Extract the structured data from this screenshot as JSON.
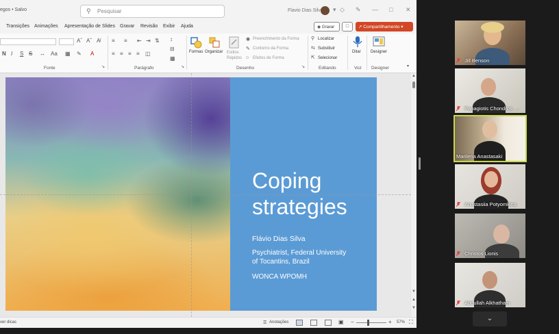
{
  "window": {
    "file_title": "egos • Salvo",
    "search_placeholder": "Pesquisar",
    "user_name": "Flavio Dias Silva"
  },
  "menu": {
    "tabs": [
      "Transições",
      "Animações",
      "Apresentação de Slides",
      "Gravar",
      "Revisão",
      "Exibir",
      "Ajuda"
    ],
    "record_label": "Gravar",
    "share_label": "Compartilhamento"
  },
  "ribbon": {
    "groups": [
      "Fonte",
      "Parágrafo",
      "Desenho",
      "Editando",
      "Voz",
      "Designer"
    ],
    "font_buttons": [
      "N",
      "I",
      "S",
      "S"
    ],
    "drawing": {
      "shapes": "Formas",
      "arrange": "Organizar",
      "quick_styles": "Estilos Rápidos",
      "fill": "Preenchimento da Forma",
      "outline": "Contorno da Forma",
      "effects": "Efeitos de Forma"
    },
    "editing": {
      "find": "Localizar",
      "replace": "Substituir",
      "select": "Selecionar"
    },
    "voice": {
      "dictate": "Ditar"
    },
    "designer": {
      "label": "Designer"
    }
  },
  "slide": {
    "title_line1": "Coping",
    "title_line2": "strategies",
    "author": "Flávio Dias Silva",
    "affiliation_line1": "Psychiatrist, Federal University",
    "affiliation_line2": "of Tocantins, Brazil",
    "organization": "WONCA WPOMH"
  },
  "status": {
    "left_text": "ver dicas",
    "notes_label": "Anotações",
    "zoom": "57%"
  },
  "participants": [
    {
      "name": "Jill Benson",
      "muted": true,
      "speaking": false
    },
    {
      "name": "Panagiotis Chondros, ...",
      "muted": true,
      "speaking": false
    },
    {
      "name": "Marilena Anastasaki",
      "muted": false,
      "speaking": true
    },
    {
      "name": "Anastasiia Potyomkina",
      "muted": true,
      "speaking": false
    },
    {
      "name": "Christos Lionis",
      "muted": true,
      "speaking": false
    },
    {
      "name": "Abdullah Alkhatham",
      "muted": true,
      "speaking": false
    }
  ],
  "colors": {
    "slide_blue": "#5b9bd5",
    "share_red": "#d24726",
    "speaker_outline": "#c9d74a",
    "mic_muted": "#e04040"
  },
  "icons": {
    "scroll_more": "chevron-down-icon"
  }
}
